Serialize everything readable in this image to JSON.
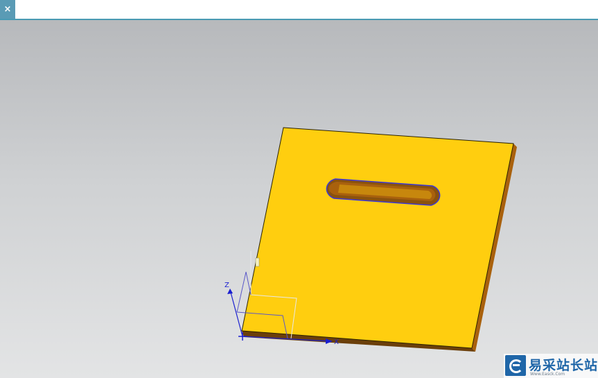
{
  "toolbar": {
    "close_label": "×",
    "title": ""
  },
  "viewport": {
    "background_top": "#b7b9bc",
    "background_bottom": "#e3e4e5",
    "part_face_color": "#ffce0f",
    "part_edge_color": "#6b3f0a",
    "slot_outline_color": "#3a38d8",
    "csys_color": "#1a1fd0"
  },
  "csys": {
    "z_label": "Z",
    "x_label": "X"
  },
  "watermark": {
    "title": "易采站长站",
    "subtitle": "Www.Easck.Com"
  }
}
